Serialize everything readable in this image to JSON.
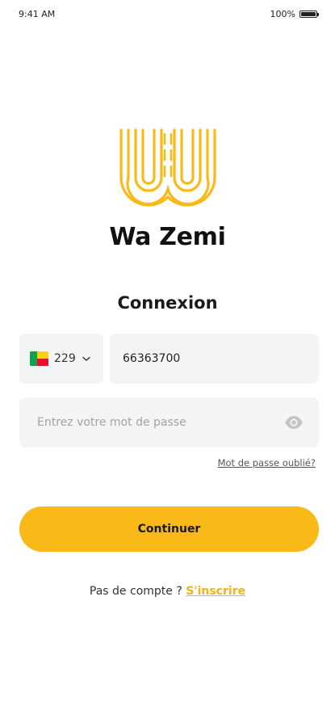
{
  "status_bar": {
    "time": "9:41 AM",
    "battery": "100%"
  },
  "brand": {
    "name": "Wa Zemi",
    "logo_color": "#f8b919"
  },
  "login": {
    "title": "Connexion",
    "country_code": "229",
    "phone_value": "66363700",
    "password_placeholder": "Entrez votre mot de passe",
    "forgot_password": "Mot de passe oublié?",
    "continue_label": "Continuer",
    "no_account_text": "Pas de compte ?",
    "signup_label": "S'inscrire"
  },
  "icons": {
    "chevron": "chevron-down-icon",
    "eye": "eye-icon",
    "flag": "benin-flag-icon",
    "battery": "battery-icon"
  },
  "colors": {
    "accent": "#f8b919",
    "field_bg": "#f3f4f6"
  }
}
